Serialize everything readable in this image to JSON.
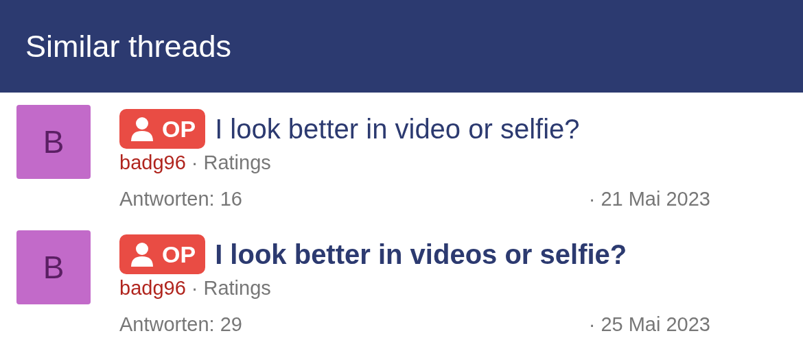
{
  "header": {
    "title": "Similar threads"
  },
  "threads": [
    {
      "avatar": "B",
      "badge": "OP",
      "title": "I look better in video or selfie?",
      "unread": false,
      "author": "badg96",
      "forum": "· Ratings",
      "replies": "Antworten: 16",
      "date": "· 21 Mai 2023"
    },
    {
      "avatar": "B",
      "badge": "OP",
      "title": "I look better in videos or selfie?",
      "unread": true,
      "author": "badg96",
      "forum": "· Ratings",
      "replies": "Antworten: 29",
      "date": "· 25 Mai 2023"
    }
  ]
}
